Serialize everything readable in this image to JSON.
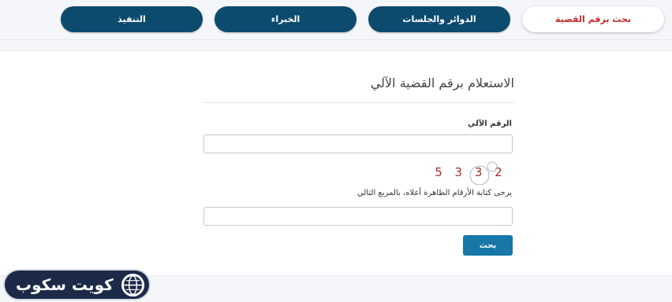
{
  "tabs": [
    {
      "label": "بحث برقم القضية",
      "active": true
    },
    {
      "label": "الدوائر والجلسات",
      "active": false
    },
    {
      "label": "الخبراء",
      "active": false
    },
    {
      "label": "التنفيذ",
      "active": false
    }
  ],
  "form": {
    "title": "الاستعلام برقم القضية الآلي",
    "auto_number_label": "الرقم الآلي",
    "auto_number_value": "",
    "captcha_digits": [
      "5",
      "3",
      "3",
      "2"
    ],
    "captcha_hint": "يرجى كتابة الأرقام الظاهرة أعلاه، بالمربع التالي",
    "captcha_value": "",
    "search_label": "بحث"
  },
  "watermark": {
    "text": "كويت سكوب"
  },
  "colors": {
    "tab_dark": "#0c4a6e",
    "tab_active_text": "#c0292b",
    "button": "#1677a8",
    "captcha_digit": "#b02a2a"
  }
}
